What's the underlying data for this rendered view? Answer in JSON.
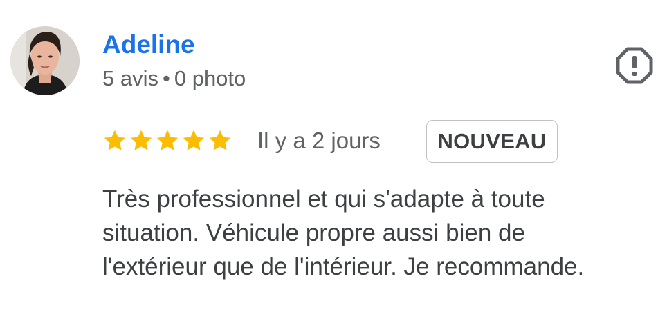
{
  "review": {
    "author": {
      "name": "Adeline",
      "reviews_count": "5 avis",
      "separator": "•",
      "photos_count": "0 photo"
    },
    "rating": 5,
    "time_ago": "Il y a 2 jours",
    "badge": "NOUVEAU",
    "text_lines": [
      "Très professionnel et qui s'adapte à toute",
      "situation. Véhicule propre aussi bien de",
      "l'extérieur que de l'intérieur. Je recommande."
    ]
  },
  "icons": {
    "report": "report-flag-icon",
    "star": "star-icon"
  },
  "colors": {
    "author_name": "#1a73e8",
    "star": "#fbbc04",
    "meta_text": "#5f6368",
    "body_text": "#3c4043",
    "badge_border": "#c2c2c2",
    "report_icon": "#5f6368"
  }
}
